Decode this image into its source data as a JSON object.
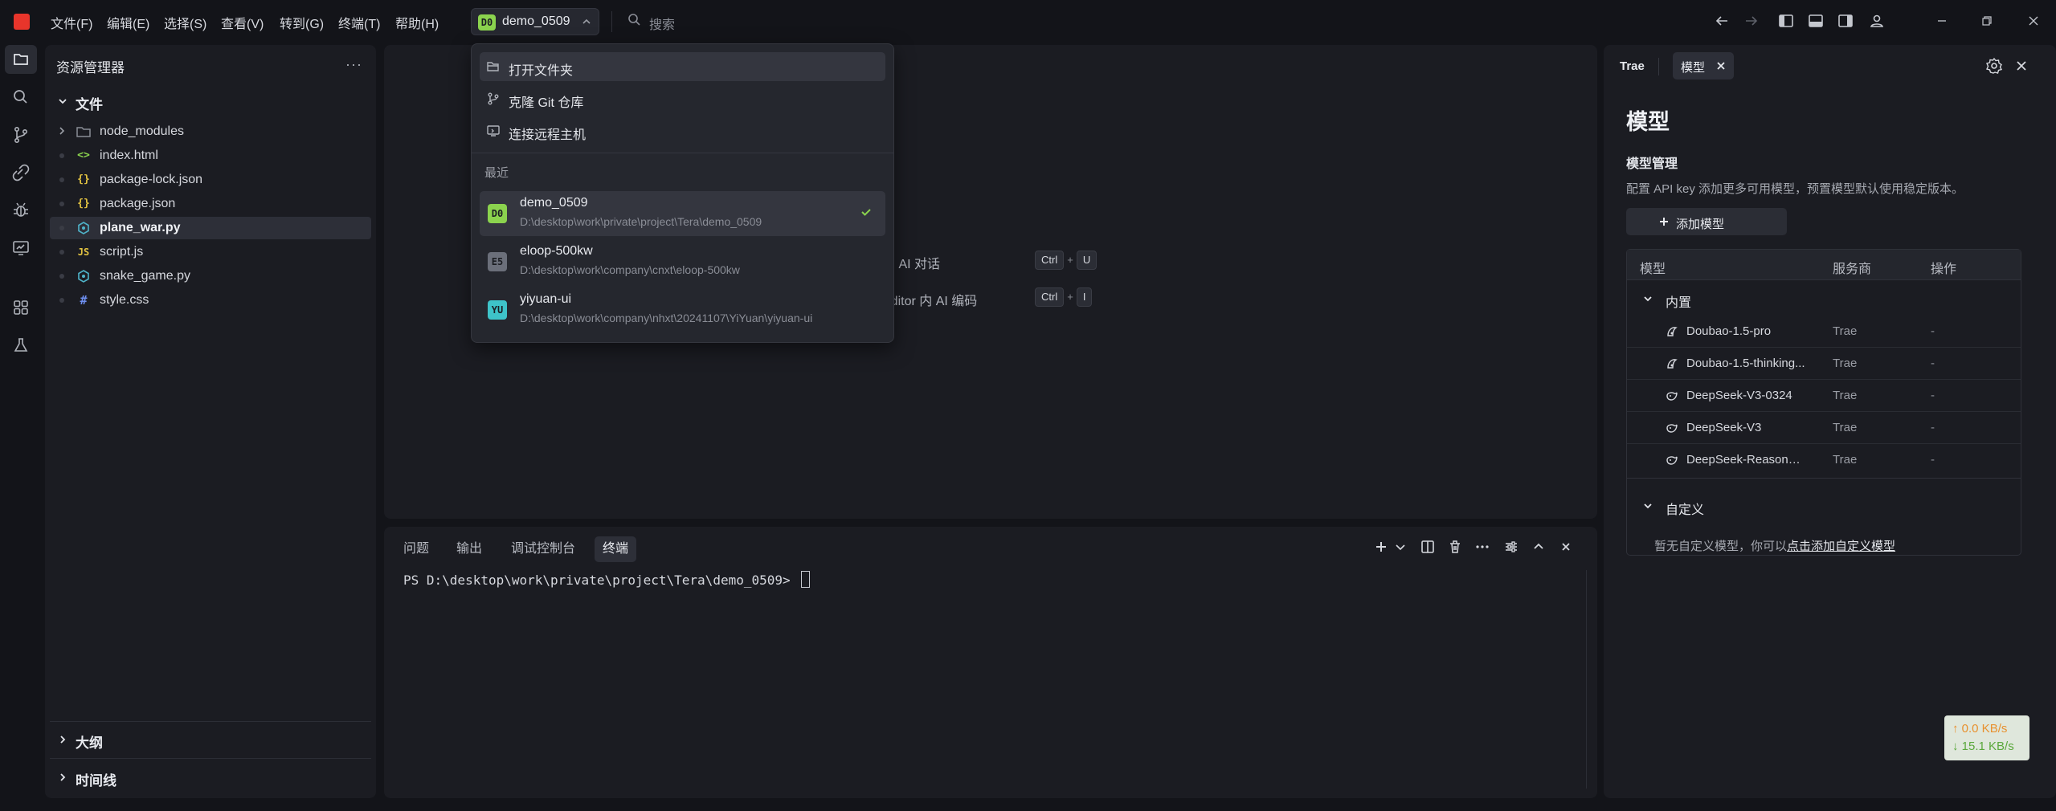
{
  "menu": {
    "items": [
      "文件(F)",
      "编辑(E)",
      "选择(S)",
      "查看(V)",
      "转到(G)",
      "终端(T)",
      "帮助(H)"
    ]
  },
  "project_switcher": {
    "badge": "D0",
    "name": "demo_0509"
  },
  "search": {
    "placeholder": "搜索"
  },
  "explorer": {
    "title": "资源管理器",
    "more": "···",
    "section": "文件",
    "items": [
      {
        "label": "node_modules",
        "icon": "folder-icon"
      },
      {
        "label": "index.html",
        "icon": "html-icon"
      },
      {
        "label": "package-lock.json",
        "icon": "json-icon"
      },
      {
        "label": "package.json",
        "icon": "json-icon"
      },
      {
        "label": "plane_war.py",
        "icon": "python-icon"
      },
      {
        "label": "script.js",
        "icon": "js-icon"
      },
      {
        "label": "snake_game.py",
        "icon": "python-icon"
      },
      {
        "label": "style.css",
        "icon": "css-icon"
      }
    ],
    "outline": "大纲",
    "timeline": "时间线"
  },
  "editor": {
    "shortcuts": [
      {
        "text": "与 AI 对话",
        "keys": [
          "Ctrl",
          "U"
        ]
      },
      {
        "text": "Editor 内 AI 编码",
        "keys": [
          "Ctrl",
          "I"
        ]
      }
    ]
  },
  "panel": {
    "tabs": [
      "问题",
      "输出",
      "调试控制台",
      "终端"
    ],
    "active_tab": "终端",
    "terminal_prompt": "PS D:\\desktop\\work\\private\\project\\Tera\\demo_0509> "
  },
  "right_panel": {
    "tab_trae": "Trae",
    "tab_model": "模型",
    "title": "模型",
    "subtitle": "模型管理",
    "description": "配置 API key 添加更多可用模型，预置模型默认使用稳定版本。",
    "add_button": "添加模型",
    "table_headers": [
      "模型",
      "服务商",
      "操作"
    ],
    "group_builtin": "内置",
    "models": [
      {
        "name": "Doubao-1.5-pro",
        "provider": "Trae",
        "op": "-"
      },
      {
        "name": "Doubao-1.5-thinking...",
        "provider": "Trae",
        "op": "-"
      },
      {
        "name": "DeepSeek-V3-0324",
        "provider": "Trae",
        "op": "-"
      },
      {
        "name": "DeepSeek-V3",
        "provider": "Trae",
        "op": "-"
      },
      {
        "name": "DeepSeek-Reasoner...",
        "provider": "Trae",
        "op": "-"
      }
    ],
    "group_custom": "自定义",
    "custom_empty": "暂无自定义模型，你可以",
    "custom_link": "点击添加自定义模型"
  },
  "network": {
    "up": "↑ 0.0 KB/s",
    "down": "↓ 15.1 KB/s"
  },
  "dropdown": {
    "actions": [
      {
        "label": "打开文件夹",
        "icon": "folder-open-icon"
      },
      {
        "label": "克隆 Git 仓库",
        "icon": "git-branch-icon"
      },
      {
        "label": "连接远程主机",
        "icon": "remote-icon"
      }
    ],
    "recent_label": "最近",
    "projects": [
      {
        "badge": "D0",
        "name": "demo_0509",
        "path": "D:\\desktop\\work\\private\\project\\Tera\\demo_0509",
        "color": "#8bd34e"
      },
      {
        "badge": "E5",
        "name": "eloop-500kw",
        "path": "D:\\desktop\\work\\company\\cnxt\\eloop-500kw",
        "color": "#6b6f7a"
      },
      {
        "badge": "YU",
        "name": "yiyuan-ui",
        "path": "D:\\desktop\\work\\company\\nhxt\\20241107\\YiYuan\\yiyuan-ui",
        "color": "#3ec3c9"
      }
    ]
  },
  "colors": {
    "accent_green": "#8bd34e",
    "logo_red": "#e8352b",
    "background": "#131419",
    "panel": "#1b1c22"
  }
}
